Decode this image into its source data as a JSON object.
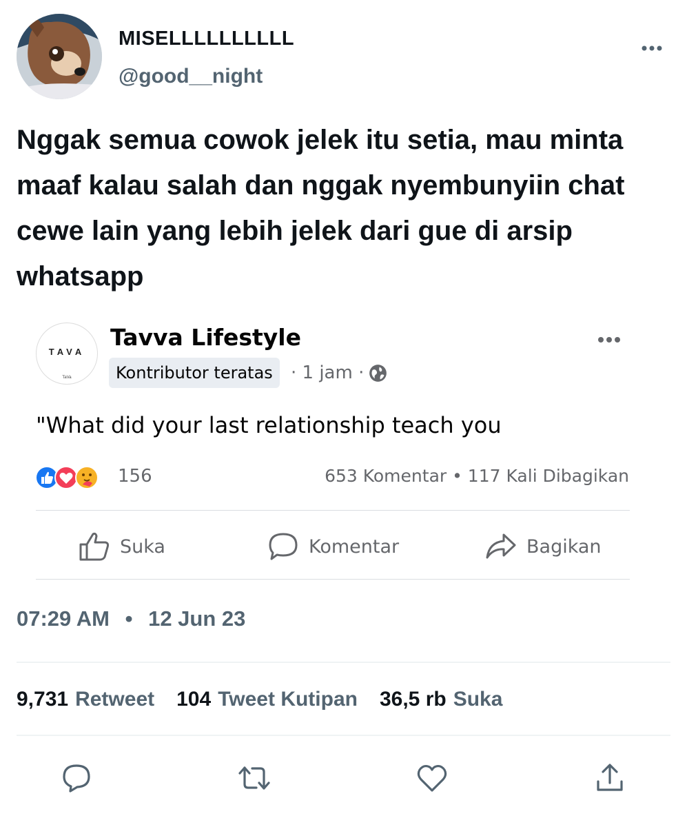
{
  "tweet": {
    "display_name": "MISELLLLLLLLLL",
    "handle": "@good__night",
    "more_icon": "more-horizontal-icon",
    "text": "Nggak semua cowok jelek itu setia, mau minta maaf kalau salah dan nggak nyembunyiin chat cewe lain yang lebih jelek dari gue di arsip whatsapp",
    "time": "07:29 AM",
    "separator": "•",
    "date": "12 Jun 23"
  },
  "embedded_post": {
    "page_name": "Tavva Lifestyle",
    "logo_text": "TAVA",
    "logo_subtext": "TaVa",
    "badge": "Kontributor teratas",
    "time": "· 1 jam ·",
    "post_text": "\"What did your last relationship teach you",
    "reaction_icons": [
      "like-icon",
      "love-icon",
      "care-icon"
    ],
    "reaction_count": "156",
    "stats": "653 Komentar • 117 Kali Dibagikan",
    "actions": {
      "like": "Suka",
      "comment": "Komentar",
      "share": "Bagikan"
    }
  },
  "stats": [
    {
      "value": "9,731",
      "label": "Retweet"
    },
    {
      "value": "104",
      "label": "Tweet Kutipan"
    },
    {
      "value": "36,5 rb",
      "label": "Suka"
    }
  ],
  "actions": [
    "reply-icon",
    "retweet-icon",
    "like-icon",
    "share-icon"
  ],
  "colors": {
    "text": "#0f1419",
    "secondary": "#536471",
    "fb_secondary": "#65676b",
    "fb_like_blue": "#1877f2",
    "fb_love_red": "#f33e58"
  }
}
